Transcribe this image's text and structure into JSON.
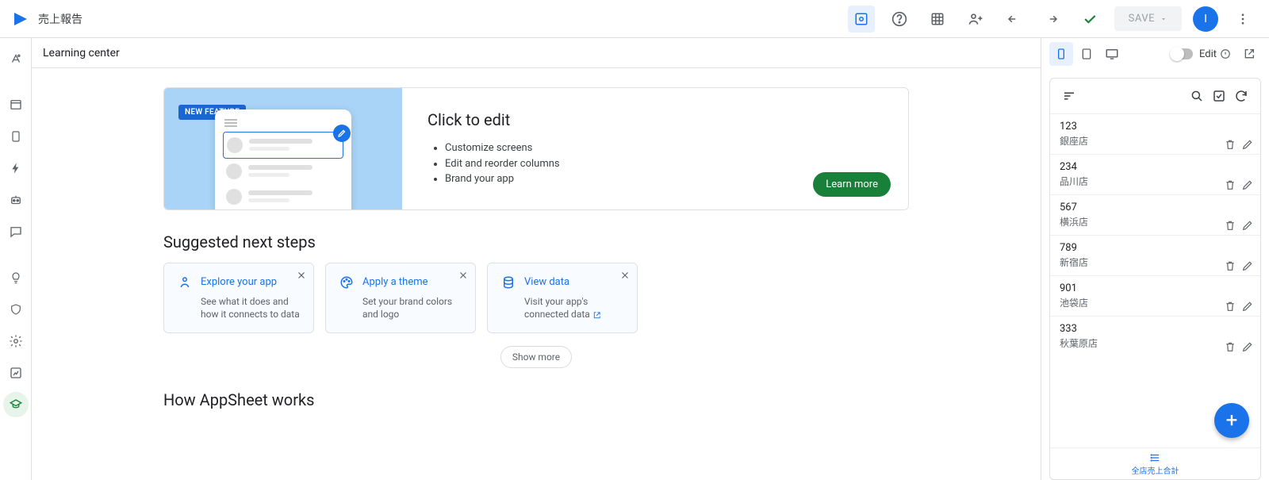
{
  "header": {
    "title": "売上報告",
    "save_label": "SAVE",
    "avatar_initial": "I"
  },
  "main": {
    "section_header": "Learning center",
    "hero": {
      "badge": "NEW FEATURE",
      "title": "Click to edit",
      "bullets": [
        "Customize screens",
        "Edit and reorder columns",
        "Brand your app"
      ],
      "cta": "Learn more"
    },
    "suggested": {
      "title": "Suggested next steps",
      "cards": [
        {
          "title": "Explore your app",
          "desc": "See what it does and how it connects to data"
        },
        {
          "title": "Apply a theme",
          "desc": "Set your brand colors and logo"
        },
        {
          "title": "View data",
          "desc": "Visit your app's connected data"
        }
      ],
      "show_more": "Show more"
    },
    "how_works": "How AppSheet works"
  },
  "preview": {
    "edit_label": "Edit",
    "items": [
      {
        "num": "123",
        "name": "銀座店"
      },
      {
        "num": "234",
        "name": "品川店"
      },
      {
        "num": "567",
        "name": "横浜店"
      },
      {
        "num": "789",
        "name": "新宿店"
      },
      {
        "num": "901",
        "name": "池袋店"
      },
      {
        "num": "333",
        "name": "秋葉原店"
      }
    ],
    "bottom_tab": "全店売上合計"
  }
}
